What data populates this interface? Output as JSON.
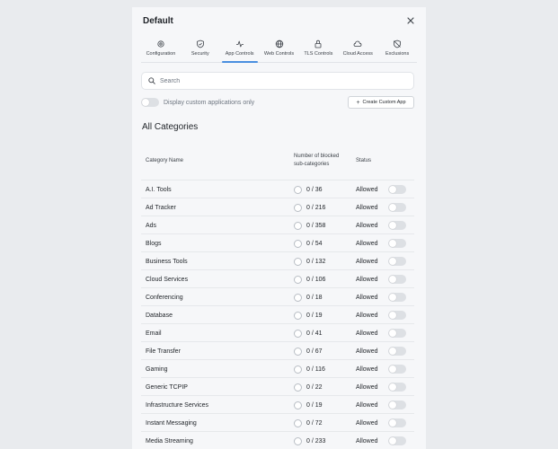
{
  "dialog": {
    "title": "Default",
    "close_icon": "close-icon"
  },
  "tabs": [
    {
      "label": "Configuration",
      "icon": "gear-icon",
      "active": false
    },
    {
      "label": "Security",
      "icon": "shield-icon",
      "active": false
    },
    {
      "label": "App Controls",
      "icon": "activity-icon",
      "active": true
    },
    {
      "label": "Web Controls",
      "icon": "globe-icon",
      "active": false
    },
    {
      "label": "TLS Controls",
      "icon": "lock-icon",
      "active": false
    },
    {
      "label": "Cloud Access",
      "icon": "cloud-icon",
      "active": false
    },
    {
      "label": "Exclusions",
      "icon": "shield-off-icon",
      "active": false
    }
  ],
  "search": {
    "placeholder": "Search",
    "value": ""
  },
  "custom_toggle": {
    "label": "Display custom applications only",
    "on": false
  },
  "create_button": {
    "label": "Create Custom App"
  },
  "section": {
    "title": "All Categories"
  },
  "table": {
    "headers": {
      "name": "Category Name",
      "blocked_line1": "Number of blocked",
      "blocked_line2": "sub-categories",
      "status": "Status"
    },
    "rows": [
      {
        "name": "A.I. Tools",
        "count": "0 / 36",
        "status": "Allowed"
      },
      {
        "name": "Ad Tracker",
        "count": "0 / 216",
        "status": "Allowed"
      },
      {
        "name": "Ads",
        "count": "0 / 358",
        "status": "Allowed"
      },
      {
        "name": "Blogs",
        "count": "0 / 54",
        "status": "Allowed"
      },
      {
        "name": "Business Tools",
        "count": "0 / 132",
        "status": "Allowed"
      },
      {
        "name": "Cloud Services",
        "count": "0 / 106",
        "status": "Allowed"
      },
      {
        "name": "Conferencing",
        "count": "0 / 18",
        "status": "Allowed"
      },
      {
        "name": "Database",
        "count": "0 / 19",
        "status": "Allowed"
      },
      {
        "name": "Email",
        "count": "0 / 41",
        "status": "Allowed"
      },
      {
        "name": "File Transfer",
        "count": "0 / 67",
        "status": "Allowed"
      },
      {
        "name": "Gaming",
        "count": "0 / 116",
        "status": "Allowed"
      },
      {
        "name": "Generic TCPIP",
        "count": "0 / 22",
        "status": "Allowed"
      },
      {
        "name": "Infrastructure Services",
        "count": "0 / 19",
        "status": "Allowed"
      },
      {
        "name": "Instant Messaging",
        "count": "0 / 72",
        "status": "Allowed"
      },
      {
        "name": "Media Streaming",
        "count": "0 / 233",
        "status": "Allowed"
      }
    ]
  },
  "colors": {
    "background": "#e9ebee",
    "panel": "#f6f7f9",
    "accent": "#4a8fe0",
    "toggle_off": "#dde0e4"
  }
}
